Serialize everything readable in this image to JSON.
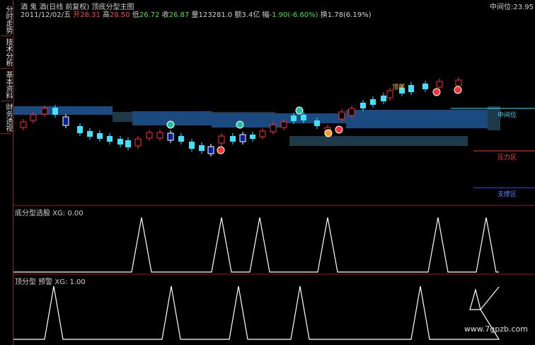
{
  "sidebar": {
    "tabs": [
      {
        "label": "分时走势"
      },
      {
        "label": "技术分析"
      },
      {
        "label": "基本资料"
      },
      {
        "label": "财务透视"
      }
    ]
  },
  "header": {
    "line1": "酒 鬼 酒(日线 前复权) 顶底分型主图",
    "date": "2011/12/02/五",
    "open_label": "开",
    "open": "28.31",
    "high_label": "高",
    "high": "28.50",
    "low_label": "低",
    "low": "26.72",
    "close_label": "收",
    "close": "26.87",
    "volume_label": "量",
    "volume": "123281.0",
    "amount_label": "额",
    "amount": "3.4亿",
    "change_label": "幅",
    "change": "-1.90(-6.60%)",
    "turnover_label": "换",
    "turnover": "1.78(6.19%)",
    "mid_label": "中间位:",
    "mid_value": "23.95"
  },
  "labels": {
    "mid": "中间位",
    "pressure": "压力区",
    "support": "支撑区",
    "peak": "顶部"
  },
  "panel2": {
    "title": "底分型选股 XG: 0.00"
  },
  "panel3": {
    "title": "顶分型 预警 XG: 1.00"
  },
  "watermark": "www.7gpzb.com",
  "colors": {
    "up": "#ff3030",
    "down": "#40e0ff",
    "band_blue": "#1a4a80",
    "band_dark": "#1e3a48",
    "tri": "#ffffff"
  }
}
